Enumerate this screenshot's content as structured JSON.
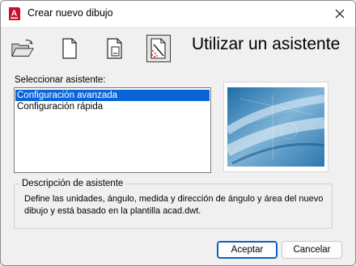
{
  "window": {
    "title": "Crear nuevo dibujo",
    "app_icon_letter": "A"
  },
  "toolbar": {
    "buttons": [
      {
        "icon": "open-folder-icon",
        "active": false
      },
      {
        "icon": "blank-page-icon",
        "active": false
      },
      {
        "icon": "template-page-icon",
        "active": false
      },
      {
        "icon": "wizard-icon",
        "active": true
      }
    ],
    "heading": "Utilizar un asistente"
  },
  "wizard_list": {
    "label": "Seleccionar asistente:",
    "items": [
      {
        "label": "Configuración avanzada",
        "selected": true
      },
      {
        "label": "Configuración rápida",
        "selected": false
      }
    ]
  },
  "preview": {
    "image": "blueprint-preview"
  },
  "description": {
    "legend": "Descripción de asistente",
    "text": "Define las unidades, ángulo, medida y dirección de ángulo y área del nuevo dibujo y está basado en la plantilla acad.dwt."
  },
  "buttons": {
    "accept_label": "Aceptar",
    "cancel_label": "Cancelar"
  },
  "colors": {
    "selection": "#0a64d8",
    "app_icon": "#c8102e"
  }
}
